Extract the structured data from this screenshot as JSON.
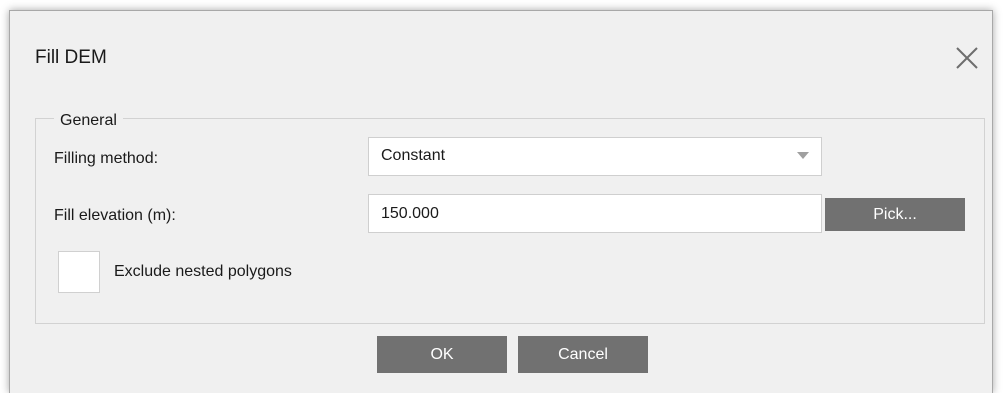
{
  "dialog": {
    "title": "Fill DEM",
    "close_icon": "close-icon"
  },
  "group": {
    "legend": "General",
    "filling_method_label": "Filling method:",
    "filling_method_value": "Constant",
    "fill_elevation_label": "Fill elevation (m):",
    "fill_elevation_value": "150.000",
    "pick_label": "Pick...",
    "exclude_label": "Exclude nested polygons",
    "exclude_checked": false
  },
  "footer": {
    "ok_label": "OK",
    "cancel_label": "Cancel"
  },
  "colors": {
    "dialog_bg": "#f0f0f0",
    "button_bg": "#717171",
    "button_text": "#ffffff"
  }
}
